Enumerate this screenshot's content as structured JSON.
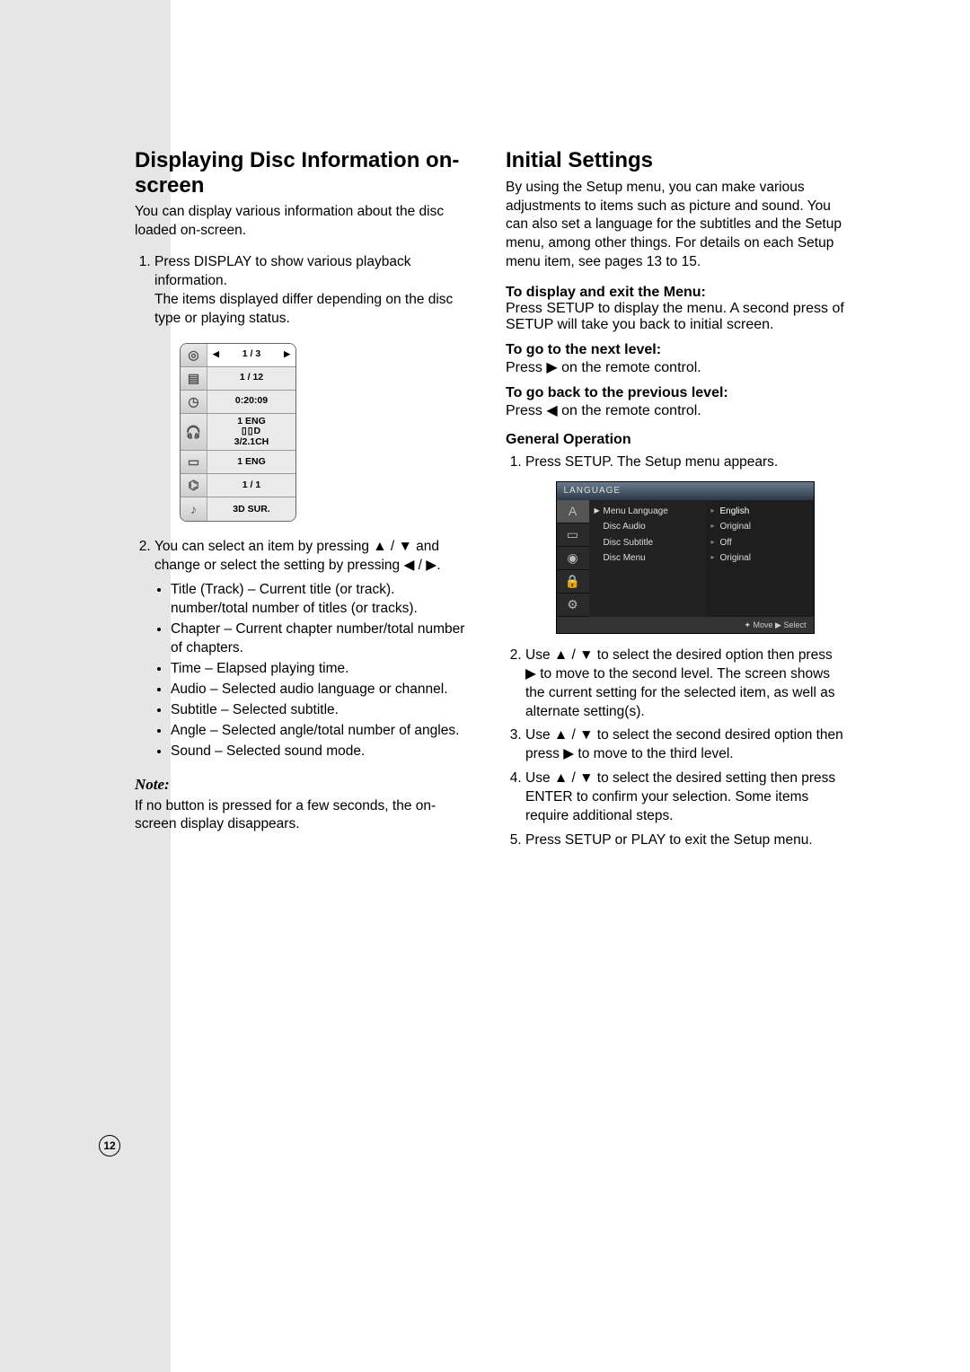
{
  "page_number": "12",
  "left": {
    "heading": "Displaying Disc Information on-screen",
    "intro": "You can display various information about the disc loaded on-screen.",
    "step1a": "Press DISPLAY to show various playback information.",
    "step1b": "The items displayed differ depending on the disc type or playing status.",
    "osd": {
      "title_left": "◀",
      "title_val": "1 / 3",
      "title_right": "▶",
      "chapter": "1 / 12",
      "time": "0:20:09",
      "audio1": "1 ENG",
      "audio2": "D",
      "audio3": "3/2.1CH",
      "subtitle": "1 ENG",
      "angle": "1 / 1",
      "sound": "3D SUR."
    },
    "step2": "You can select an item by pressing ▲ / ▼ and change or select the setting by pressing ◀ / ▶.",
    "bullets": {
      "b1": "Title (Track) – Current title (or track). number/total number of titles (or tracks).",
      "b2": "Chapter – Current chapter number/total number of chapters.",
      "b3": "Time – Elapsed playing time.",
      "b4": "Audio – Selected audio language or channel.",
      "b5": "Subtitle – Selected subtitle.",
      "b6": "Angle – Selected angle/total number of angles.",
      "b7": "Sound – Selected sound mode."
    },
    "note_h": "Note:",
    "note": "If no button is pressed for a few seconds, the on-screen display disappears."
  },
  "right": {
    "heading": "Initial Settings",
    "intro": "By using the Setup menu, you can make various adjustments to items such as picture and sound. You can also set a language for the subtitles and the Setup menu, among other things. For details on each Setup menu item, see pages 13 to 15.",
    "inst1h": "To display and exit the Menu:",
    "inst1": "Press SETUP to display the menu. A second press of SETUP will take you back to initial screen.",
    "inst2h": "To go to the next level:",
    "inst2": "Press ▶ on the remote control.",
    "inst3h": "To go back to the previous level:",
    "inst3": "Press ◀ on the remote control.",
    "genop_h": "General Operation",
    "gen1": "Press SETUP. The Setup menu appears.",
    "setup": {
      "title": "LANGUAGE",
      "items": {
        "i1": "Menu Language",
        "i2": "Disc Audio",
        "i3": "Disc Subtitle",
        "i4": "Disc Menu"
      },
      "values": {
        "v1": "English",
        "v2": "Original",
        "v3": "Off",
        "v4": "Original"
      },
      "footer": "✦ Move ▶ Select"
    },
    "gen2": "Use ▲ / ▼ to select the desired option then press ▶ to move to the second level. The screen shows the current setting for the selected item, as well as alternate setting(s).",
    "gen3": "Use ▲ / ▼ to select the second desired option then press ▶ to move to the third level.",
    "gen4": "Use ▲ / ▼ to select the desired setting then press ENTER to confirm your selection. Some items require additional steps.",
    "gen5": "Press SETUP or PLAY to exit the Setup menu."
  }
}
